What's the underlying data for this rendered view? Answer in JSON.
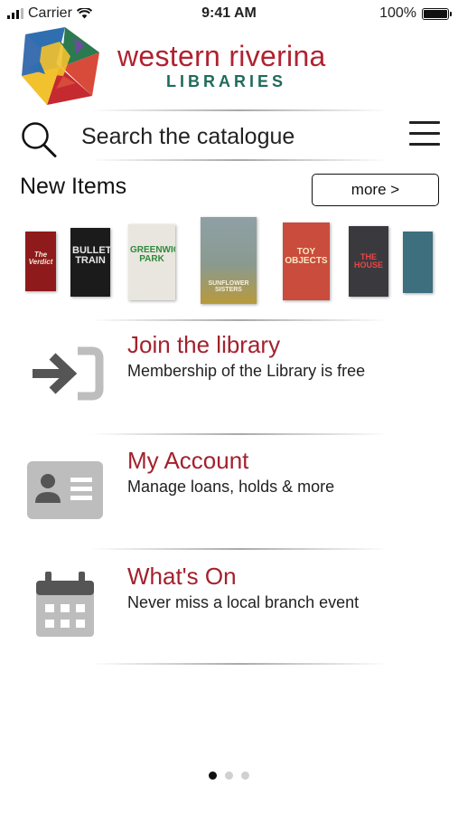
{
  "status_bar": {
    "carrier": "Carrier",
    "time": "9:41 AM",
    "battery": "100%",
    "battery_level": 1.0
  },
  "header": {
    "brand_name": "western riverina",
    "brand_sub": "LIBRARIES",
    "colors": {
      "brand_red": "#b02230",
      "brand_green": "#1f6b5c"
    }
  },
  "search": {
    "placeholder": "Search the catalogue",
    "icon": "search-icon",
    "menu_icon": "hamburger-menu-icon"
  },
  "new_items": {
    "title": "New Items",
    "more_label": "more >",
    "books": [
      {
        "title": "The Verdict",
        "color": "#8e1a1c"
      },
      {
        "title": "BULLET TRAIN",
        "color": "#1b1b1b"
      },
      {
        "title": "GREENWICH PARK",
        "color": "#e9e6df"
      },
      {
        "title": "SUNFLOWER SISTERS",
        "color": "#8a9a8f"
      },
      {
        "title": "TOY OBJECTS",
        "color": "#c94c3c"
      },
      {
        "title": "THE HOUSE",
        "color": "#3a3a3e"
      },
      {
        "title": "",
        "color": "#3d6f7e"
      }
    ]
  },
  "menu": [
    {
      "title": "Join the library",
      "description": "Membership of the Library is free",
      "icon": "sign-in-arrow-icon"
    },
    {
      "title": "My Account",
      "description": "Manage loans, holds & more",
      "icon": "id-card-icon"
    },
    {
      "title": "What's On",
      "description": "Never miss a local branch event",
      "icon": "calendar-icon"
    }
  ],
  "pagination": {
    "pages": 3,
    "current": 1
  }
}
